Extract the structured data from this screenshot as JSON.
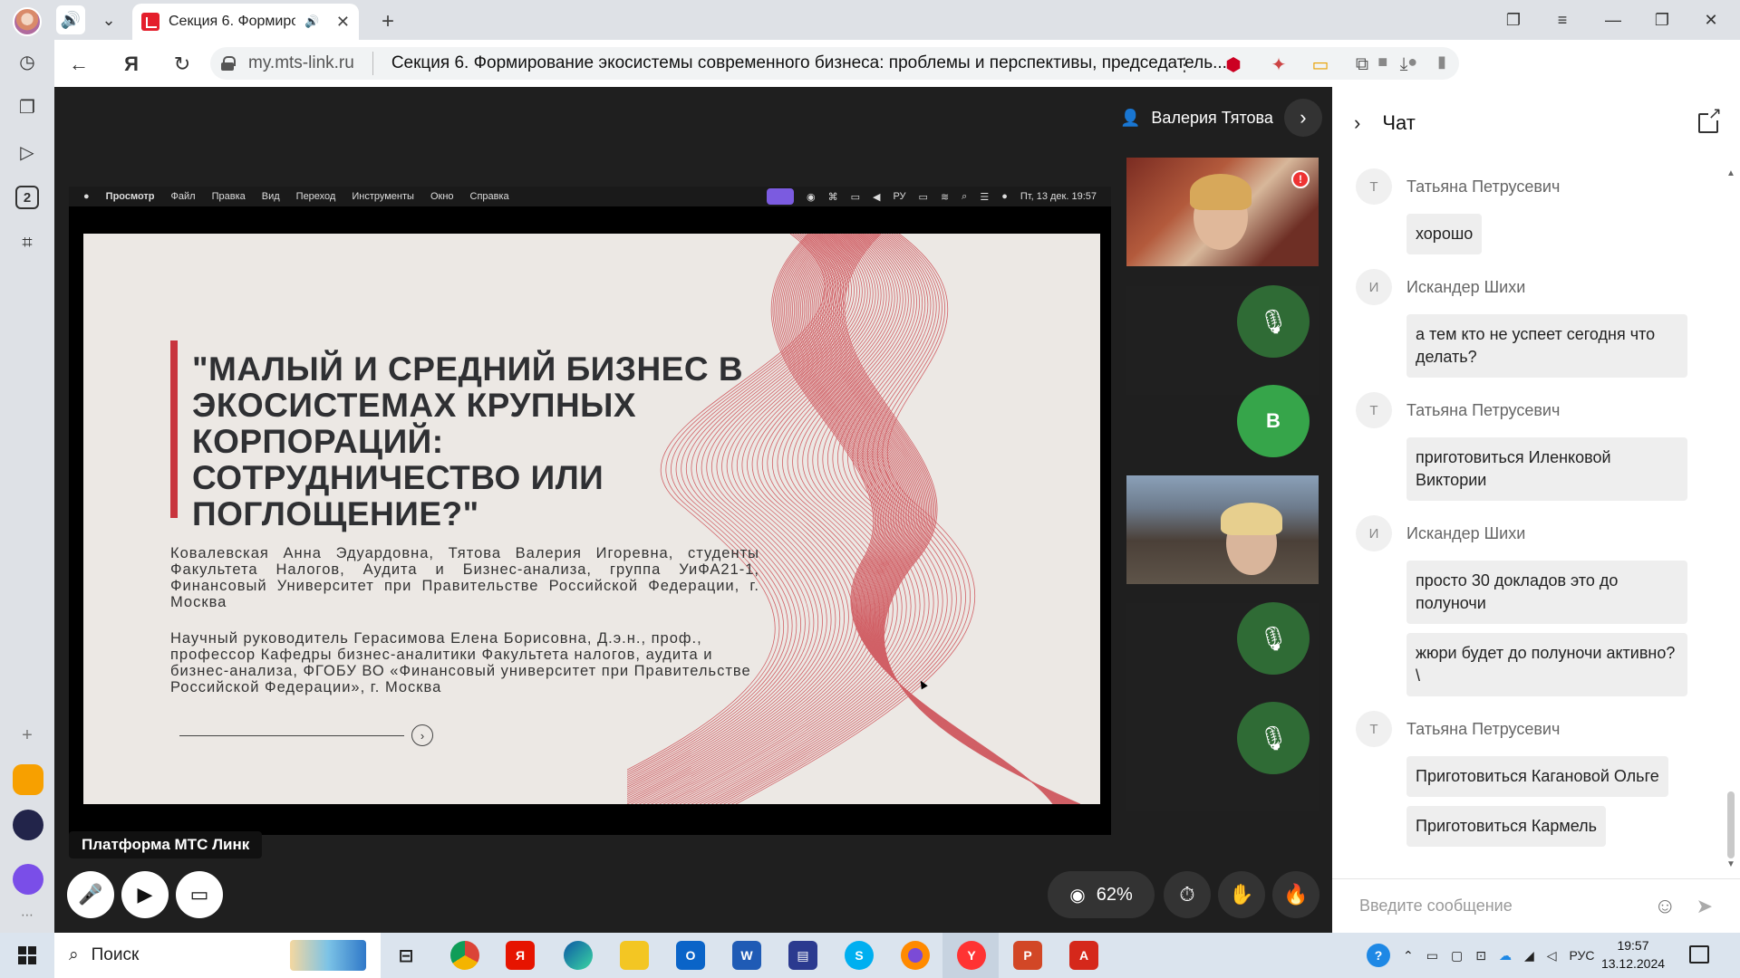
{
  "browser": {
    "tab_title": "Секция 6. Формиро",
    "url": "my.mts-link.ru",
    "page_title": "Секция 6. Формирование экосистемы современного бизнеса: проблемы и перспективы, председатель..."
  },
  "mac_menu": {
    "items": [
      "Просмотр",
      "Файл",
      "Правка",
      "Вид",
      "Переход",
      "Инструменты",
      "Окно",
      "Справка"
    ],
    "datetime": "Пт, 13 дек. 19:57"
  },
  "slide": {
    "title": "\"МАЛЫЙ И СРЕДНИЙ БИЗНЕС В ЭКОСИСТЕМАХ КРУПНЫХ КОРПОРАЦИЙ: СОТРУДНИЧЕСТВО ИЛИ ПОГЛОЩЕНИЕ?\"",
    "authors": "Ковалевская Анна Эдуардовна, Тятова Валерия Игоревна, студенты Факультета Налогов, Аудита и Бизнес-анализа, группа УиФА21-1, Финансовый Университет при Правительстве Российской Федерации, г. Москва",
    "advisor": "Научный руководитель Герасимова Елена Борисовна, Д.э.н., проф., профессор Кафедры бизнес-аналитики Факультета налогов, аудита и бизнес-анализа, ФГОБУ ВО «Финансовый университет при Правительстве Российской Федерации», г. Москва"
  },
  "meeting": {
    "speaker_name": "Валерия Тятова",
    "share_label": "Платформа МТС Линк",
    "avatar_letter": "В",
    "views_percent": "62%"
  },
  "chat": {
    "title": "Чат",
    "input_placeholder": "Введите сообщение",
    "groups": [
      {
        "initial": "Т",
        "author": "Татьяна Петрусевич",
        "messages": [
          "хорошо"
        ]
      },
      {
        "initial": "И",
        "author": "Искандер Шихи",
        "messages": [
          "а тем кто не успеет сегодня что делать?"
        ]
      },
      {
        "initial": "Т",
        "author": "Татьяна Петрусевич",
        "messages": [
          "приготовиться Иленковой Виктории"
        ]
      },
      {
        "initial": "И",
        "author": "Искандер Шихи",
        "messages": [
          "просто 30 докладов это до полуночи",
          "жюри будет до полуночи активно?\\"
        ]
      },
      {
        "initial": "Т",
        "author": "Татьяна Петрусевич",
        "messages": [
          "Приготовиться Кагановой Ольге",
          "Приготовиться Кармель"
        ]
      }
    ]
  },
  "taskbar": {
    "search_label": "Поиск",
    "lang": "РУС",
    "time": "19:57",
    "date": "13.12.2024"
  },
  "colors": {
    "accent_red": "#e41e2b",
    "mic_off_green": "#2f6b35",
    "avatar_green": "#36a54a",
    "slide_bar": "#c8343d"
  }
}
